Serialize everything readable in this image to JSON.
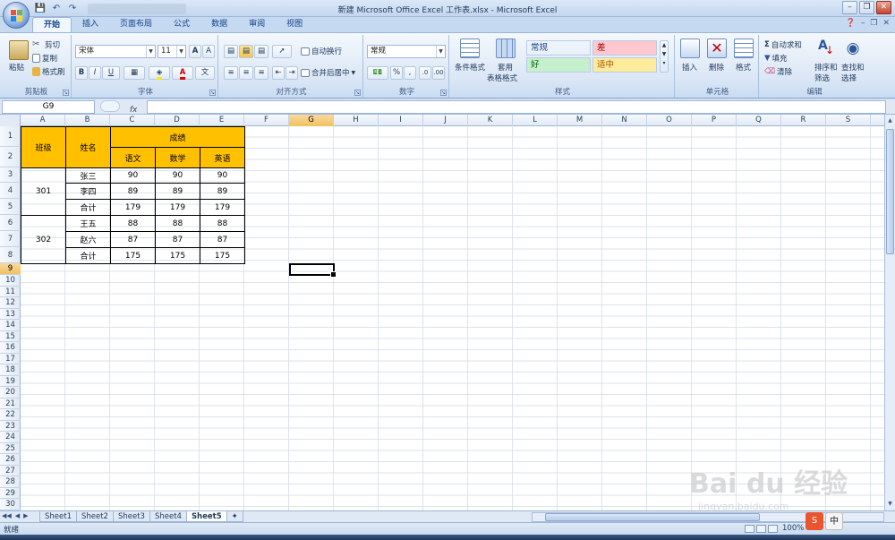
{
  "window": {
    "title": "新建 Microsoft Office Excel 工作表.xlsx - Microsoft Excel",
    "controls": [
      "minimize-icon",
      "restore-icon",
      "close-icon"
    ]
  },
  "quick_access": [
    "save-icon",
    "undo-icon",
    "redo-icon"
  ],
  "ribbon": {
    "tabs": [
      "开始",
      "插入",
      "页面布局",
      "公式",
      "数据",
      "审阅",
      "视图"
    ],
    "active_tab": "开始",
    "clipboard": {
      "label": "剪贴板",
      "paste": "粘贴",
      "cut": "剪切",
      "copy": "复制",
      "format_painter": "格式刷"
    },
    "font": {
      "label": "字体",
      "font_name": "宋体",
      "font_size": "11",
      "bold": "B",
      "italic": "I",
      "underline": "U"
    },
    "alignment": {
      "label": "对齐方式",
      "wrap_text": "自动换行",
      "merge_center": "合并后居中"
    },
    "number": {
      "label": "数字",
      "format": "常规",
      "percent": "%",
      "comma": ","
    },
    "styles": {
      "label": "样式",
      "conditional_format": "条件格式",
      "format_as_table_1": "套用",
      "format_as_table_2": "表格格式",
      "cells": [
        {
          "text": "常规",
          "bg": "#ffffff",
          "fg": "#000000"
        },
        {
          "text": "差",
          "bg": "#ffc7ce",
          "fg": "#9c0006"
        },
        {
          "text": "好",
          "bg": "#c6efce",
          "fg": "#006100"
        },
        {
          "text": "适中",
          "bg": "#ffeb9c",
          "fg": "#9c5700"
        }
      ]
    },
    "cells_group": {
      "label": "单元格",
      "insert": "插入",
      "delete": "删除",
      "format": "格式"
    },
    "editing": {
      "label": "编辑",
      "autosum": "自动求和",
      "fill": "填充",
      "clear": "清除",
      "sort_filter_1": "排序和",
      "sort_filter_2": "筛选",
      "find_select_1": "查找和",
      "find_select_2": "选择"
    }
  },
  "formula_bar": {
    "name_box": "G9",
    "fx": "fx",
    "value": ""
  },
  "columns": [
    "A",
    "B",
    "C",
    "D",
    "E",
    "F",
    "G",
    "H",
    "I",
    "J",
    "K",
    "L",
    "M",
    "N",
    "O",
    "P",
    "Q",
    "R",
    "S"
  ],
  "selected_column": "G",
  "rows": [
    "1",
    "2",
    "3",
    "4",
    "5",
    "6",
    "7",
    "8",
    "9",
    "10",
    "11",
    "12",
    "13",
    "14",
    "15",
    "16",
    "17",
    "18",
    "19",
    "20",
    "21",
    "22",
    "23",
    "24",
    "25",
    "26",
    "27",
    "28",
    "29",
    "30"
  ],
  "selected_row": "9",
  "table": {
    "class_header": "班级",
    "name_header": "姓名",
    "score_header": "成绩",
    "subjects": [
      "语文",
      "数学",
      "英语"
    ],
    "header_color": "#ffc000",
    "groups": [
      {
        "class": "301",
        "rows": [
          {
            "name": "张三",
            "scores": [
              "90",
              "90",
              "90"
            ]
          },
          {
            "name": "李四",
            "scores": [
              "89",
              "89",
              "89"
            ]
          },
          {
            "name": "合计",
            "scores": [
              "179",
              "179",
              "179"
            ]
          }
        ]
      },
      {
        "class": "302",
        "rows": [
          {
            "name": "王五",
            "scores": [
              "88",
              "88",
              "88"
            ]
          },
          {
            "name": "赵六",
            "scores": [
              "87",
              "87",
              "87"
            ]
          },
          {
            "name": "合计",
            "scores": [
              "175",
              "175",
              "175"
            ]
          }
        ]
      }
    ]
  },
  "sheets": [
    "Sheet1",
    "Sheet2",
    "Sheet3",
    "Sheet4",
    "Sheet5"
  ],
  "active_sheet": "Sheet5",
  "status": {
    "ready": "就绪",
    "zoom": "100%"
  },
  "ime": {
    "s_badge": "S",
    "zhong": "中"
  },
  "watermark": {
    "line1": "Bai du 经验",
    "line2": "jingyan.baidu.com"
  }
}
